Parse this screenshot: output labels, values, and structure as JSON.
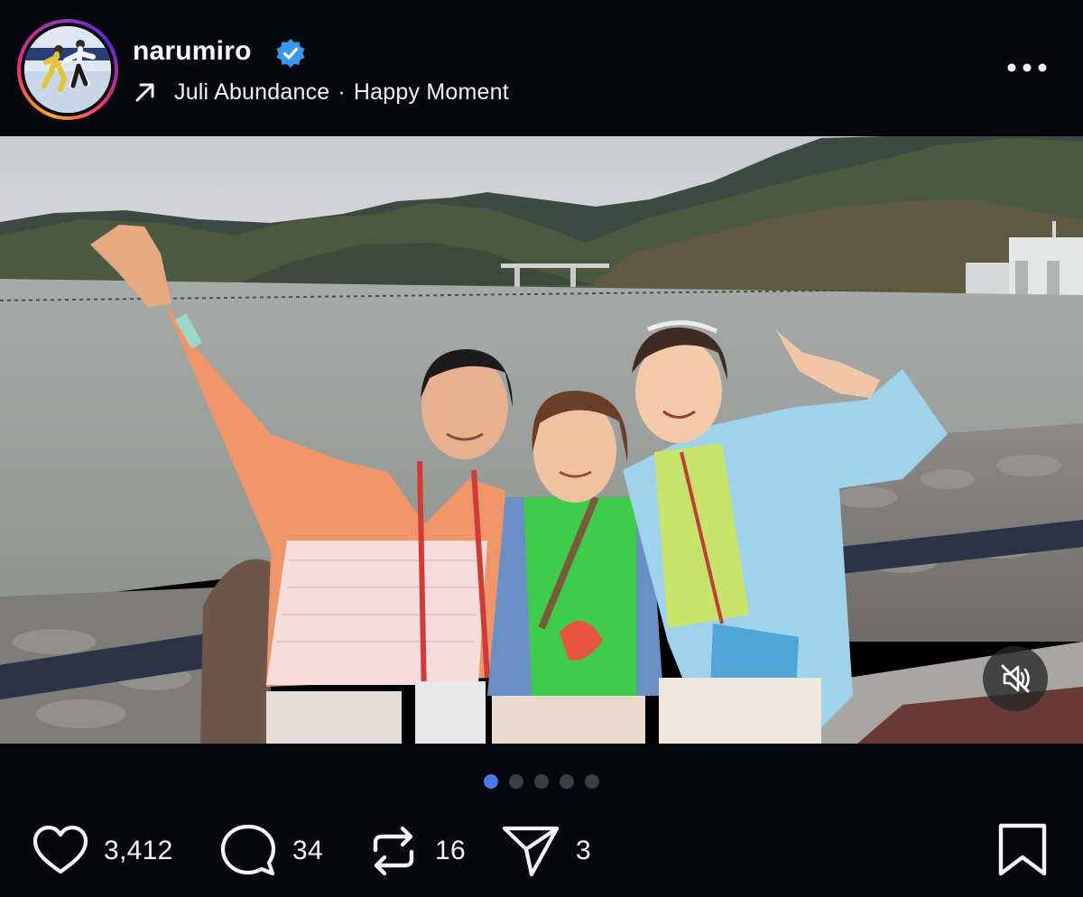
{
  "post": {
    "username": "narumiro",
    "verified": true,
    "music_artist": "Juli Abundance",
    "music_separator": "·",
    "music_title": "Happy Moment",
    "more_icon": "more-horizontal-icon"
  },
  "media": {
    "carousel_count": 5,
    "carousel_active": 1,
    "muted": true,
    "mute_icon": "speaker-muted-icon"
  },
  "actions": {
    "likes": "3,412",
    "comments": "34",
    "reposts": "16",
    "shares": "3",
    "icons": [
      "heart-icon",
      "comment-bubble-icon",
      "repost-icon",
      "send-icon",
      "bookmark-icon"
    ]
  },
  "colors": {
    "background": "#06080c",
    "verified_badge": "#3897f0",
    "active_dot": "#4a78ef",
    "inactive_dot": "#3c3f46"
  }
}
